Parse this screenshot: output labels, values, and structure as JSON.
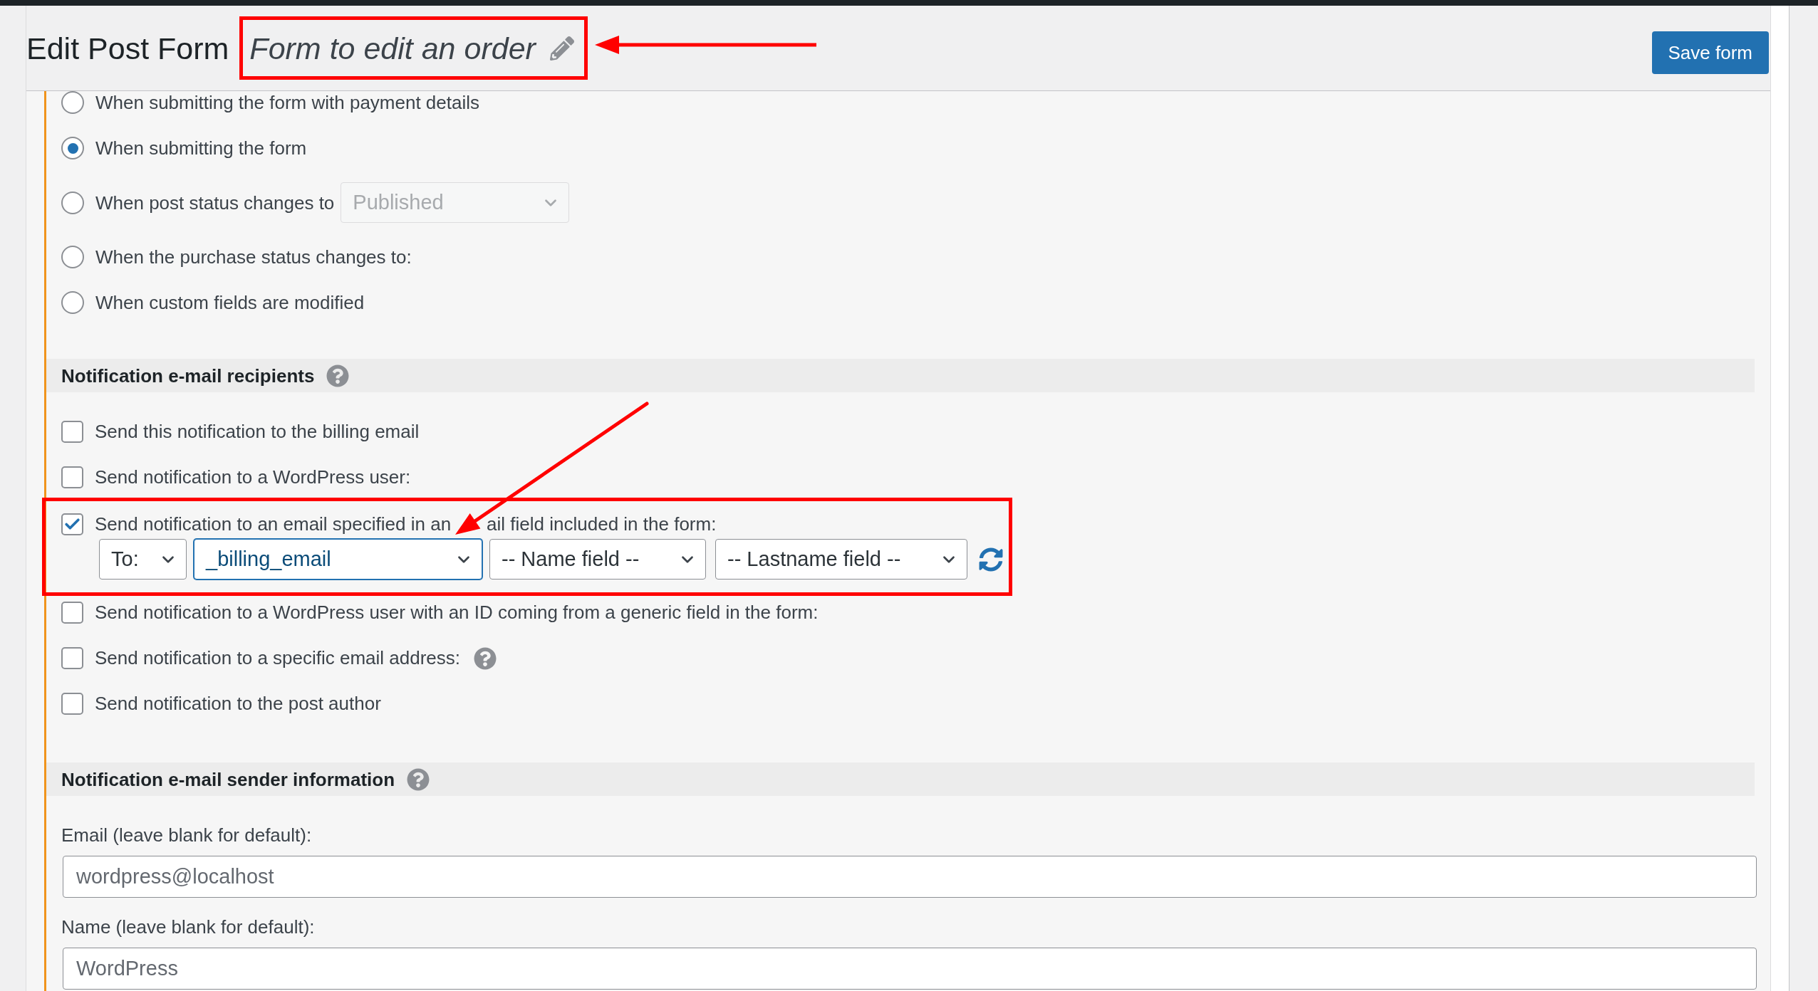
{
  "header": {
    "title": "Edit Post Form",
    "form_name": "Form to edit an order",
    "form_name_annotated": true,
    "save_button": "Save form"
  },
  "trigger_options": [
    {
      "label": "When submitting the form with payment details",
      "selected": false,
      "kind": "plain"
    },
    {
      "label": "When submitting the form",
      "selected": true,
      "kind": "plain"
    },
    {
      "label": "When post status changes to",
      "selected": false,
      "kind": "select",
      "select": {
        "value": "Published",
        "disabled": true
      }
    },
    {
      "label": "When the purchase status changes to:",
      "selected": false,
      "kind": "plain"
    },
    {
      "label": "When custom fields are modified",
      "selected": false,
      "kind": "plain"
    }
  ],
  "recipients": {
    "title": "Notification e-mail recipients",
    "help": true,
    "options": [
      {
        "label": "Send this notification to the billing email",
        "checked": false,
        "kind": "plain",
        "annotated": false
      },
      {
        "label": "Send notification to a WordPress user:",
        "checked": false,
        "kind": "plain",
        "annotated": false
      },
      {
        "label": "Send notification to an email specified in an",
        "label_end": "ail field included in the form:",
        "checked": true,
        "kind": "fields",
        "annotated": true,
        "fields": [
          {
            "value": "To:",
            "focused": false
          },
          {
            "value": "_billing_email",
            "focused": true
          },
          {
            "value": "-- Name field --",
            "focused": false
          },
          {
            "value": "-- Lastname field --",
            "focused": false
          }
        ]
      },
      {
        "label": "Send notification to a WordPress user with an ID coming from a generic field in the form:",
        "checked": false,
        "kind": "plain",
        "annotated": false
      },
      {
        "label": "Send notification to a specific email address:",
        "checked": false,
        "kind": "help",
        "annotated": false
      },
      {
        "label": "Send notification to the post author",
        "checked": false,
        "kind": "plain",
        "annotated": false
      }
    ]
  },
  "sender": {
    "title": "Notification e-mail sender information",
    "help": true,
    "fields": [
      {
        "label": "Email (leave blank for default):",
        "placeholder": "wordpress@localhost"
      },
      {
        "label": "Name (leave blank for default):",
        "placeholder": "WordPress"
      }
    ]
  }
}
